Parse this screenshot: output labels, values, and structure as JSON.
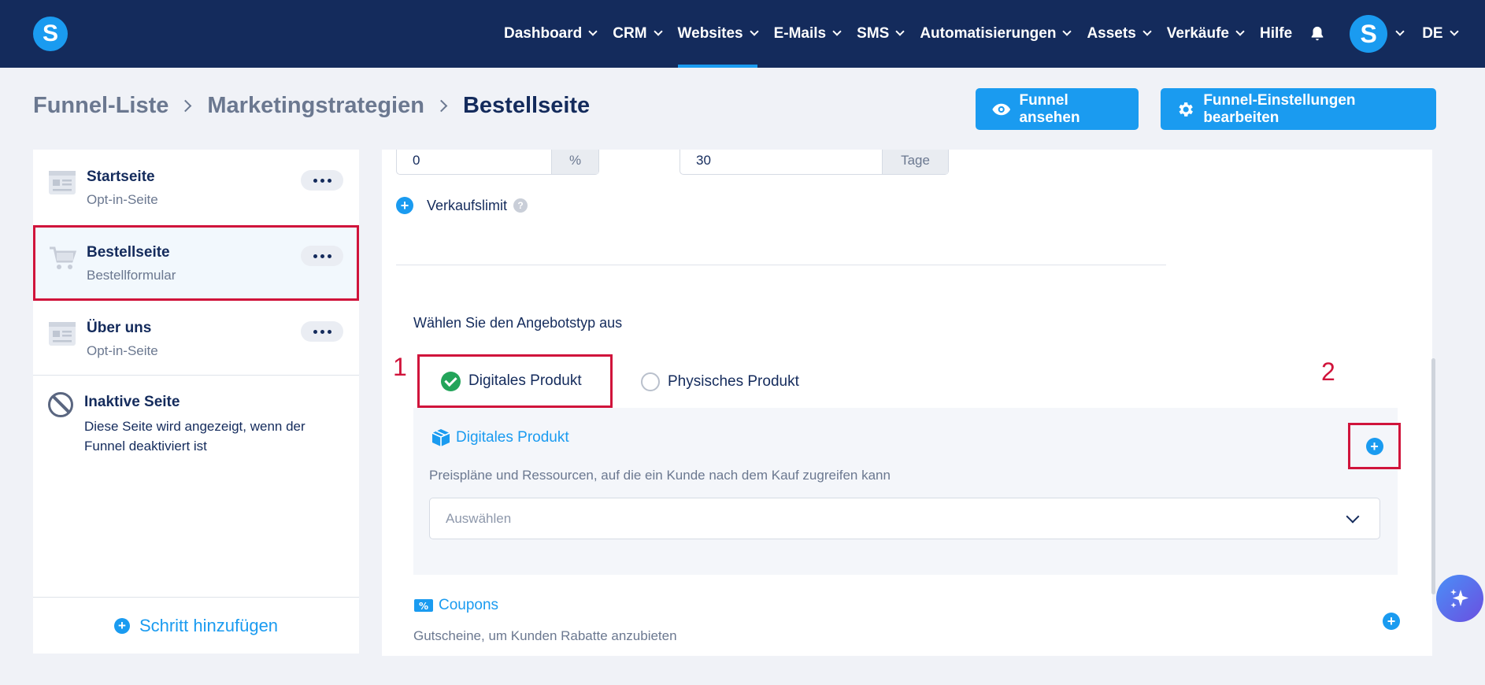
{
  "logo": {
    "letter": "S"
  },
  "nav": {
    "items": [
      {
        "label": "Dashboard",
        "has_menu": true
      },
      {
        "label": "CRM",
        "has_menu": true
      },
      {
        "label": "Websites",
        "has_menu": true,
        "active": true
      },
      {
        "label": "E-Mails",
        "has_menu": true
      },
      {
        "label": "SMS",
        "has_menu": true
      },
      {
        "label": "Automatisierungen",
        "has_menu": true
      },
      {
        "label": "Assets",
        "has_menu": true
      },
      {
        "label": "Verkäufe",
        "has_menu": true
      },
      {
        "label": "Hilfe",
        "has_menu": false
      }
    ],
    "avatar_letter": "S",
    "language": "DE"
  },
  "breadcrumb": [
    "Funnel-Liste",
    "Marketingstrategien",
    "Bestellseite"
  ],
  "actions": {
    "view_funnel": "Funnel ansehen",
    "edit_settings": "Funnel-Einstellungen bearbeiten"
  },
  "sidebar": {
    "steps": [
      {
        "title": "Startseite",
        "subtitle": "Opt-in-Seite",
        "icon": "page-icon"
      },
      {
        "title": "Bestellseite",
        "subtitle": "Bestellformular",
        "icon": "cart-icon",
        "selected": true
      },
      {
        "title": "Über uns",
        "subtitle": "Opt-in-Seite",
        "icon": "page-icon"
      }
    ],
    "inactive": {
      "title": "Inaktive Seite",
      "description": "Diese Seite wird angezeigt, wenn der Funnel deaktiviert ist"
    },
    "add_step": "Schritt hinzufügen"
  },
  "main": {
    "discount": {
      "value": "0",
      "unit": "%"
    },
    "period": {
      "value": "30",
      "unit": "Tage"
    },
    "sales_limit": "Verkaufslimit",
    "help": "?",
    "offer_type_label": "Wählen Sie den Angebotstyp aus",
    "options": {
      "digital": "Digitales Produkt",
      "physical": "Physisches Produkt"
    },
    "digital_section": {
      "title": "Digitales Produkt",
      "description": "Preispläne und Ressourcen, auf die ein Kunde nach dem Kauf zugreifen kann",
      "select_placeholder": "Auswählen"
    },
    "coupons": {
      "title": "Coupons",
      "description": "Gutscheine, um Kunden Rabatte anzubieten"
    }
  },
  "annotations": {
    "one": "1",
    "two": "2"
  },
  "colors": {
    "nav_bg": "#142b5c",
    "accent": "#1a9bf0",
    "highlight": "#d0143b",
    "success": "#23a45a"
  }
}
